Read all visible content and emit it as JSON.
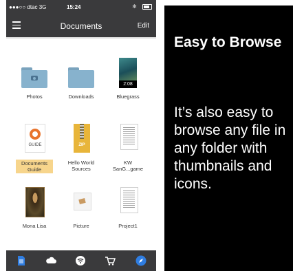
{
  "status_bar": {
    "carrier": "●●●○○ dtac  3G",
    "time": "15:24"
  },
  "nav": {
    "title": "Documents",
    "edit_label": "Edit"
  },
  "files": [
    {
      "label": "Photos",
      "kind": "folder-photos"
    },
    {
      "label": "Downloads",
      "kind": "folder"
    },
    {
      "label": "Bluegrass",
      "kind": "video",
      "duration": "2:08"
    },
    {
      "label": "Documents\nGuide",
      "kind": "guide",
      "thumb_text": "GUIDE",
      "selected": true
    },
    {
      "label": "Hello World\nSources",
      "kind": "zip",
      "thumb_text": "ZIP"
    },
    {
      "label": "KW\nSanG...game",
      "kind": "doc"
    },
    {
      "label": "Mona Lisa",
      "kind": "image"
    },
    {
      "label": "Picture",
      "kind": "picture"
    },
    {
      "label": "Project1",
      "kind": "doc"
    }
  ],
  "toolbar": {
    "items": [
      "document-icon",
      "cloud-icon",
      "wifi-icon",
      "cart-icon",
      "compass-icon"
    ],
    "active_color": "#2f7de1"
  },
  "panel": {
    "title": "Easy to Browse",
    "body": "It’s also easy to browse any file in any folder with thumbnails and icons."
  }
}
